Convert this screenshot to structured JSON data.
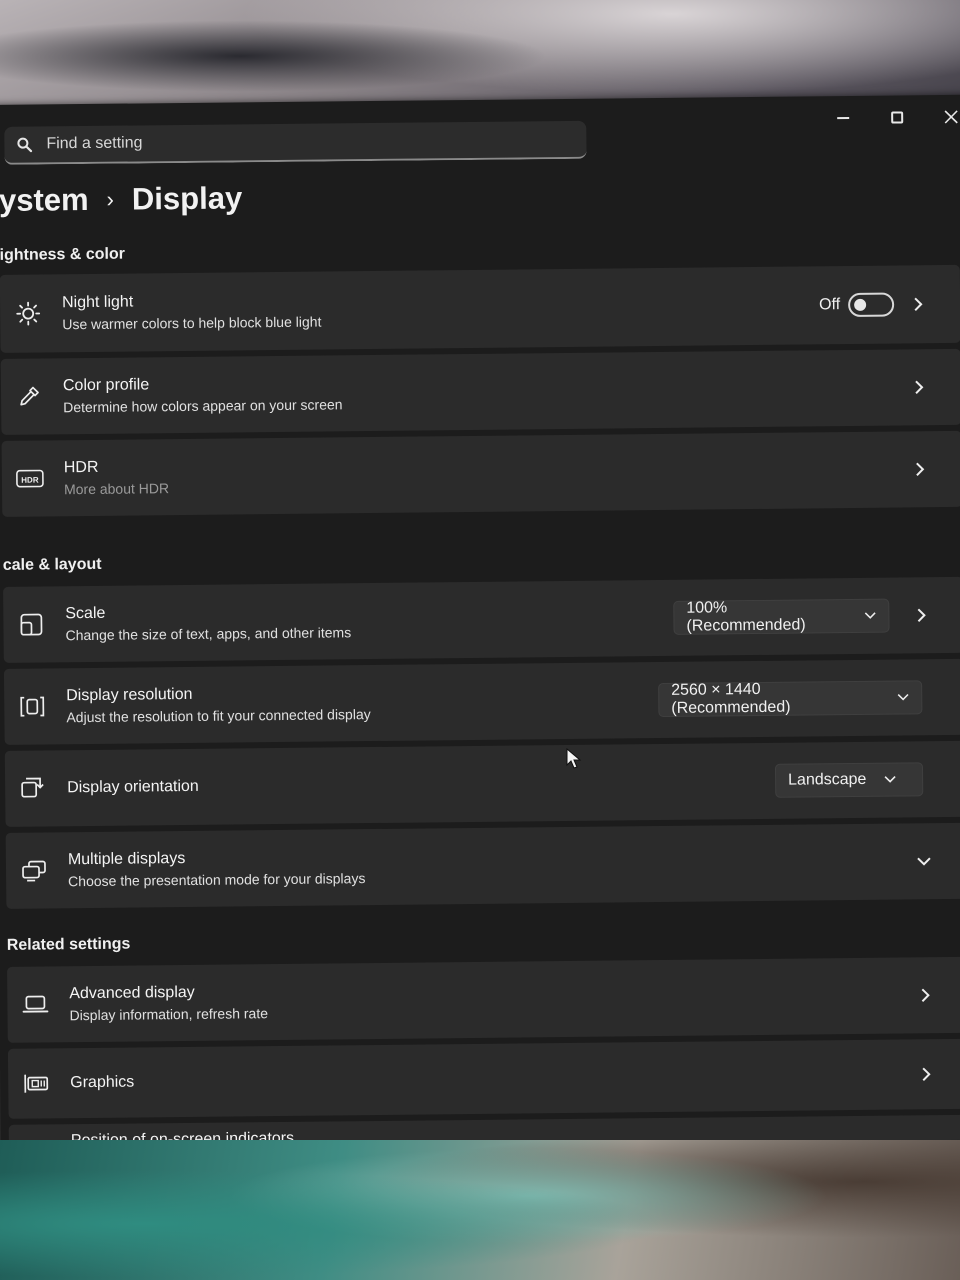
{
  "search": {
    "placeholder": "Find a setting"
  },
  "breadcrumb": {
    "parent": "ystem",
    "separator": "›",
    "current": "Display"
  },
  "sections": {
    "brightness": "ightness & color",
    "scale_layout": "cale & layout",
    "related": "Related settings"
  },
  "night_light": {
    "title": "Night light",
    "subtitle": "Use warmer colors to help block blue light",
    "state": "Off"
  },
  "color_profile": {
    "title": "Color profile",
    "subtitle": "Determine how colors appear on your screen"
  },
  "hdr": {
    "title": "HDR",
    "subtitle": "More about HDR",
    "icon_text": "HDR"
  },
  "scale": {
    "title": "Scale",
    "subtitle": "Change the size of text, apps, and other items",
    "value": "100% (Recommended)"
  },
  "resolution": {
    "title": "Display resolution",
    "subtitle": "Adjust the resolution to fit your connected display",
    "value": "2560 × 1440 (Recommended)"
  },
  "orientation": {
    "title": "Display orientation",
    "value": "Landscape"
  },
  "multiple": {
    "title": "Multiple displays",
    "subtitle": "Choose the presentation mode for your displays"
  },
  "advanced": {
    "title": "Advanced display",
    "subtitle": "Display information, refresh rate"
  },
  "graphics": {
    "title": "Graphics"
  },
  "indicators": {
    "title": "Position of on-screen indicators"
  }
}
